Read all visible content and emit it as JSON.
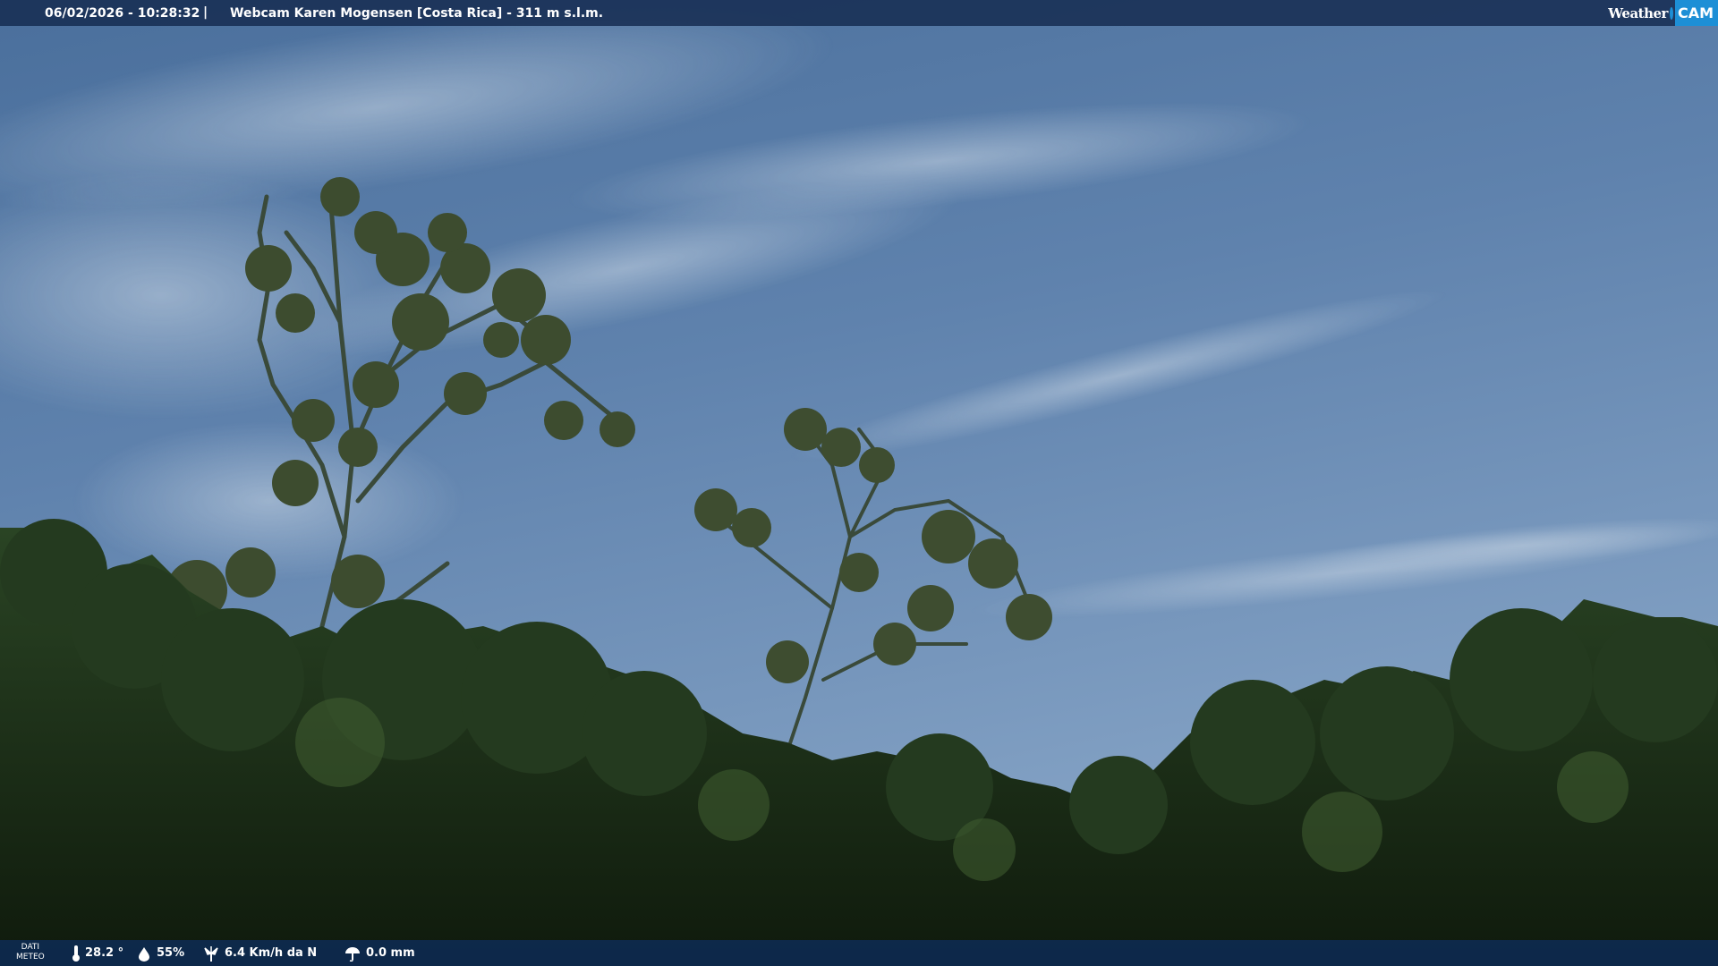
{
  "header": {
    "timestamp": "06/02/2026 - 10:28:32",
    "separator": "|",
    "title": "Webcam Karen Mogensen [Costa Rica] - 311 m s.l.m."
  },
  "logo": {
    "weather": "Weather",
    "cam": "CAM",
    "accent_color": "#1d8fd6"
  },
  "footer": {
    "dati_label_line1": "DATI",
    "dati_label_line2": "METEO",
    "temperature": "28.2 °",
    "humidity": "55%",
    "wind": "6.4 Km/h da N",
    "rain": "0.0 mm"
  },
  "icons": [
    "thermometer-icon",
    "humidity-icon",
    "wind-icon",
    "rain-icon"
  ],
  "scene": {
    "description_colors": {
      "sky_top": "#3f6594",
      "sky_bottom": "#7f9dbf",
      "foliage_dark": "#14210f"
    }
  }
}
